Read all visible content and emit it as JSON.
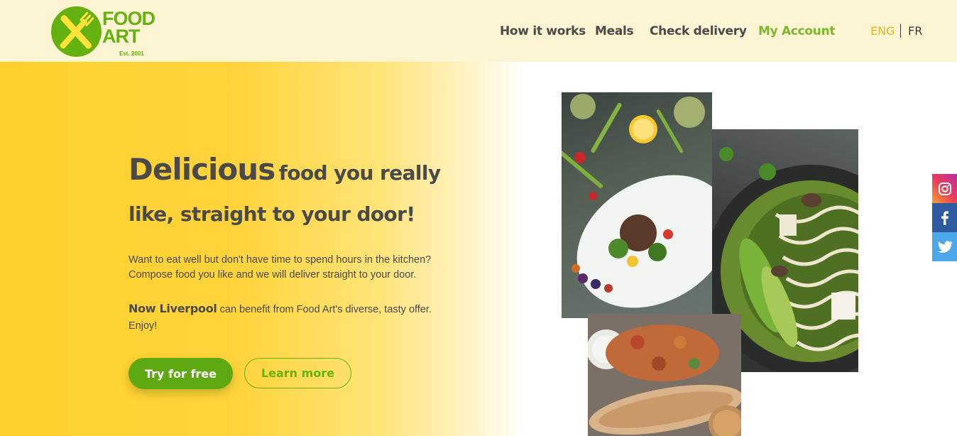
{
  "brand": {
    "logo_line1": "FOOD",
    "logo_line2": "ART",
    "logo_est": "Est. 2001",
    "accent": "#65b10f",
    "yellow": "#ffd02c"
  },
  "nav": {
    "items": [
      {
        "label": "How it works"
      },
      {
        "label": "Meals"
      },
      {
        "label": "Check delivery"
      },
      {
        "label": "My Account"
      }
    ]
  },
  "lang": {
    "eng": "ENG",
    "fr": "FR"
  },
  "hero": {
    "headline_big": "Delicious",
    "headline_rest": "food you really like, straight to your door!",
    "desc": "Want to eat well but don't have time to spend hours in the kitchen? Compose food you like and we will deliver straight to your door.",
    "offer_highlight": "Now Liverpool",
    "offer_rest": "can benefit from Food Art's diverse, tasty offer. Enjoy!",
    "btn_primary": "Try for free",
    "btn_secondary": "Learn more"
  },
  "social": {
    "icons": [
      "instagram-icon",
      "facebook-icon",
      "twitter-icon"
    ]
  }
}
